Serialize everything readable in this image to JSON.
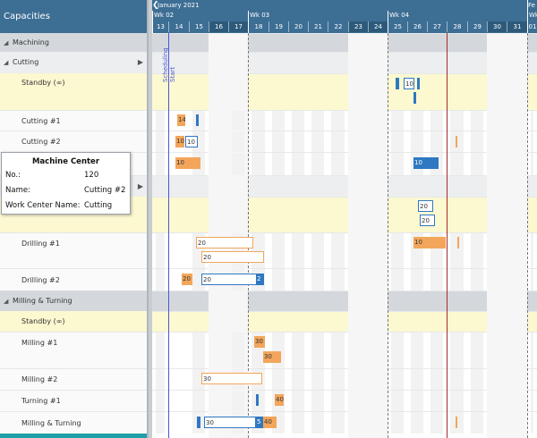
{
  "panel": {
    "title": "Capacities"
  },
  "rows": [
    {
      "kind": "group",
      "label": "Machining",
      "expanded": true
    },
    {
      "kind": "sub",
      "label": "Cutting"
    },
    {
      "kind": "standby",
      "label": "Standby (∞)"
    },
    {
      "kind": "res",
      "label": "Cutting #1"
    },
    {
      "kind": "res",
      "label": "Cutting #2"
    },
    {
      "kind": "res",
      "label": ""
    },
    {
      "kind": "sub",
      "label": ""
    },
    {
      "kind": "standby",
      "label": ""
    },
    {
      "kind": "res",
      "label": "Drilling #1"
    },
    {
      "kind": "res",
      "label": "Drilling #2"
    },
    {
      "kind": "sub",
      "label": "Milling & Turning"
    },
    {
      "kind": "standby",
      "label": "Standby (∞)"
    },
    {
      "kind": "res",
      "label": "Milling #1"
    },
    {
      "kind": "res",
      "label": "Milling #2"
    },
    {
      "kind": "res",
      "label": "Turning #1"
    },
    {
      "kind": "res",
      "label": "Milling & Turning"
    }
  ],
  "timeline": {
    "month": "January 2021",
    "month_next": "Fe",
    "weeks": [
      "Wk 02",
      "Wk 03",
      "Wk 04",
      "Wk"
    ],
    "days": [
      "13",
      "14",
      "15",
      "16",
      "17",
      "18",
      "19",
      "20",
      "21",
      "22",
      "23",
      "24",
      "25",
      "26",
      "27",
      "28",
      "29",
      "30",
      "31",
      "01"
    ],
    "scheduling_label": "Scheduling Start"
  },
  "tooltip": {
    "title": "Machine Center",
    "no_label": "No.:",
    "no_value": "120",
    "name_label": "Name:",
    "name_value": "Cutting #2",
    "wc_label": "Work Center Name:",
    "wc_value": "Cutting"
  },
  "bars": {
    "b1": "14",
    "b2": "10",
    "b3": "10",
    "b4": "10",
    "b5": "10",
    "b6": "10",
    "b7": "20",
    "b8": "20",
    "b9": "10",
    "b10": "20",
    "b11": "20",
    "b12": "20",
    "b13": "30",
    "b14": "30",
    "b15": "30",
    "b16": "40",
    "b17": "30",
    "b18": "40",
    "b19": "20",
    "b20": "20",
    "b21": "20",
    "b22": "10",
    "b23": "2",
    "b24": "5"
  },
  "colors": {
    "header": "#3d6e94",
    "orange": "#f3a65b",
    "blue": "#2f78c2",
    "standby": "#fcf8d0"
  }
}
